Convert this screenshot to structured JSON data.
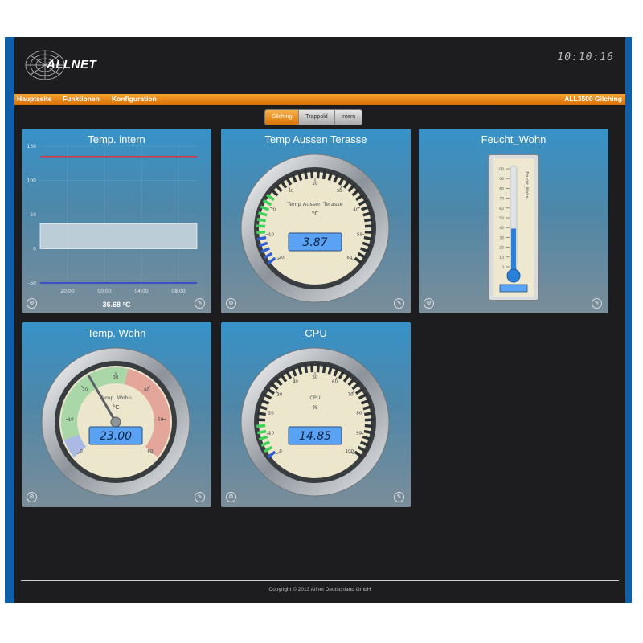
{
  "header": {
    "logo_text": "ALLNET",
    "clock": "10:10:16"
  },
  "nav": {
    "items": [
      "Hauptseite",
      "Funktionen",
      "Konfiguration"
    ],
    "site_name": "ALL3500 Gilching"
  },
  "tabs": [
    "Gilching",
    "Trappold",
    "intern"
  ],
  "panels": {
    "temp_intern": {
      "title": "Temp. intern",
      "value_label": "36.68 °C",
      "chart_data": {
        "type": "area",
        "y_ticks": [
          "150",
          "100",
          "50",
          "0",
          "-50"
        ],
        "x_ticks": [
          "20:00",
          "00:00",
          "04:00",
          "08:00"
        ],
        "ylim": [
          -50,
          150
        ],
        "series": [
          {
            "values": [
              36.68,
              36.68,
              36.68,
              36.68,
              36.68,
              36.68,
              37.2
            ]
          }
        ],
        "max_line": 135,
        "min_line": -50
      }
    },
    "temp_aussen": {
      "title": "Temp Aussen Terasse",
      "gauge_label": "Temp Aussen Terasse",
      "unit": "°C",
      "display": "3.87",
      "value": 3.87,
      "ticks": [
        "-20",
        "-10",
        "0",
        "10",
        "20",
        "30",
        "40",
        "50",
        "60"
      ]
    },
    "feucht_wohn": {
      "title": "Feucht_Wohn",
      "thermo_label": "Feucht_Wohn",
      "value": 39,
      "ticks": [
        "100",
        "90",
        "80",
        "70",
        "60",
        "50",
        "40",
        "30",
        "20",
        "10",
        "0"
      ]
    },
    "temp_wohn": {
      "title": "Temp. Wohn",
      "gauge_label": "Temp. Wohn",
      "unit": "°C",
      "display": "23.00",
      "value": 23.0,
      "ticks": [
        "0",
        "10",
        "20",
        "30",
        "40",
        "50",
        "60"
      ]
    },
    "cpu": {
      "title": "CPU",
      "gauge_label": "CPU",
      "unit": "%",
      "display": "14.85",
      "value": 14.85,
      "ticks": [
        "0",
        "10",
        "20",
        "30",
        "40",
        "50",
        "60",
        "70",
        "80",
        "90",
        "100"
      ]
    }
  },
  "footer": {
    "copyright": "Copyright © 2013 Allnet Deutschland GmbH"
  },
  "colors": {
    "accent": "#f0901c",
    "frame": "#0e5fa8",
    "background": "#1d1d20",
    "lcd": "#5aa2f3"
  }
}
